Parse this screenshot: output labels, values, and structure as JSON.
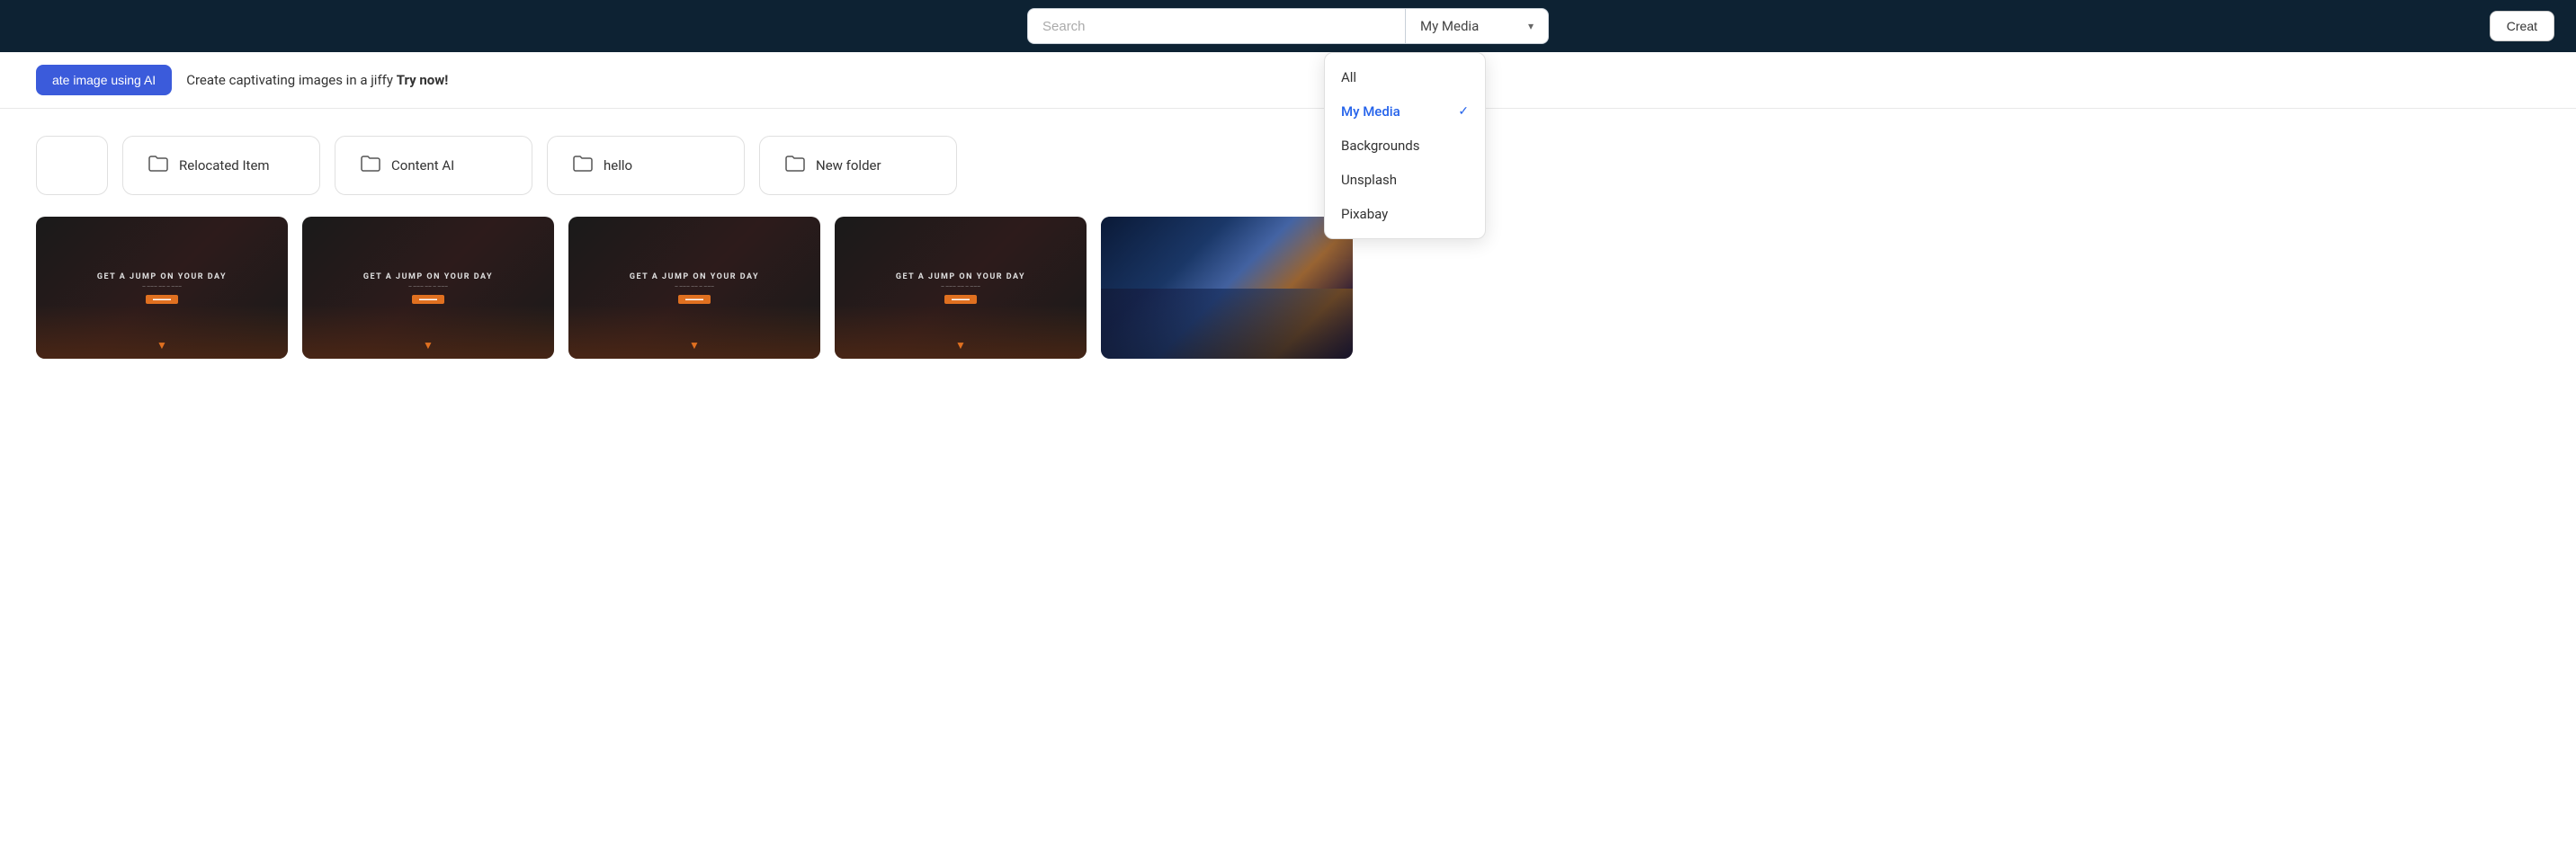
{
  "header": {
    "search_placeholder": "Search",
    "dropdown_label": "My Media",
    "create_label": "Creat"
  },
  "dropdown_menu": {
    "items": [
      {
        "id": "all",
        "label": "All",
        "active": false
      },
      {
        "id": "my-media",
        "label": "My Media",
        "active": true
      },
      {
        "id": "backgrounds",
        "label": "Backgrounds",
        "active": false
      },
      {
        "id": "unsplash",
        "label": "Unsplash",
        "active": false
      },
      {
        "id": "pixabay",
        "label": "Pixabay",
        "active": false
      }
    ]
  },
  "ai_banner": {
    "button_label": "ate image using AI",
    "text_plain": "Create captivating images in a jiffy ",
    "text_bold": "Try now!"
  },
  "folders": [
    {
      "id": "folder-placeholder",
      "label": ""
    },
    {
      "id": "relocated-item",
      "label": "Relocated Item"
    },
    {
      "id": "content-ai",
      "label": "Content AI"
    },
    {
      "id": "hello",
      "label": "hello"
    },
    {
      "id": "new-folder",
      "label": "New folder"
    }
  ],
  "media_thumbnails": [
    {
      "id": "thumb-1",
      "title": "GET A JUMP ON YOUR DAY",
      "type": "dark"
    },
    {
      "id": "thumb-2",
      "title": "GET A JUMP ON YOUR DAY",
      "type": "dark"
    },
    {
      "id": "thumb-3",
      "title": "GET A JUMP ON YOUR DAY",
      "type": "dark"
    },
    {
      "id": "thumb-4",
      "title": "GET A JUMP ON YOUR DAY",
      "type": "dark"
    },
    {
      "id": "thumb-5",
      "title": "",
      "type": "anime"
    }
  ],
  "icons": {
    "folder": "🗂",
    "chevron_down": "▾",
    "check": "✓"
  }
}
